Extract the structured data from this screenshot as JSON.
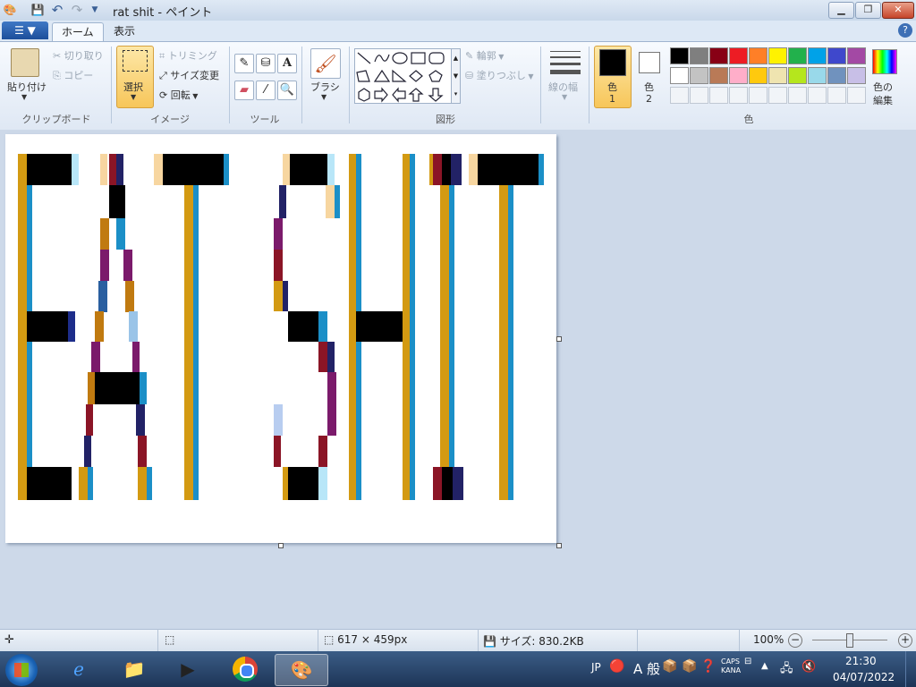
{
  "window": {
    "title": "rat shit - ペイント"
  },
  "tabs": {
    "file": "▼",
    "home": "ホーム",
    "view": "表示"
  },
  "clipboard": {
    "paste": "貼り付け",
    "cut": "切り取り",
    "copy": "コピー",
    "label": "クリップボード"
  },
  "image": {
    "select": "選択",
    "crop": "トリミング",
    "resize": "サイズ変更",
    "rotate": "回転",
    "label": "イメージ"
  },
  "tools": {
    "label": "ツール",
    "text_glyph": "A"
  },
  "brushes": {
    "label": "ブラシ"
  },
  "shapes": {
    "outline": "輪郭",
    "fill": "塗りつぶし",
    "label": "図形"
  },
  "size": {
    "label": "線の幅"
  },
  "colors": {
    "color1": "色\n1",
    "color1_line1": "色",
    "color1_line2": "1",
    "color2_line1": "色",
    "color2_line2": "2",
    "edit_line1": "色の",
    "edit_line2": "編集",
    "label": "色",
    "color1_value": "#000000",
    "color2_value": "#ffffff",
    "palette_row1": [
      "#000000",
      "#7f7f7f",
      "#880015",
      "#ed1c24",
      "#ff7f27",
      "#fff200",
      "#22b14c",
      "#00a2e8",
      "#3f48cc",
      "#a349a4"
    ],
    "palette_row2": [
      "#ffffff",
      "#c3c3c3",
      "#b97a57",
      "#ffaec9",
      "#ffc90e",
      "#efe4b0",
      "#b5e61d",
      "#99d9ea",
      "#7092be",
      "#c8bfe7"
    ]
  },
  "status": {
    "dimensions": "617 × 459px",
    "size": "サイズ: 830.2KB",
    "zoom": "100%"
  },
  "taskbar": {
    "lang": "JP",
    "ime": "A 般",
    "caps": "CAPS",
    "kana": "KANA",
    "time": "21:30",
    "date": "04/07/2022"
  }
}
